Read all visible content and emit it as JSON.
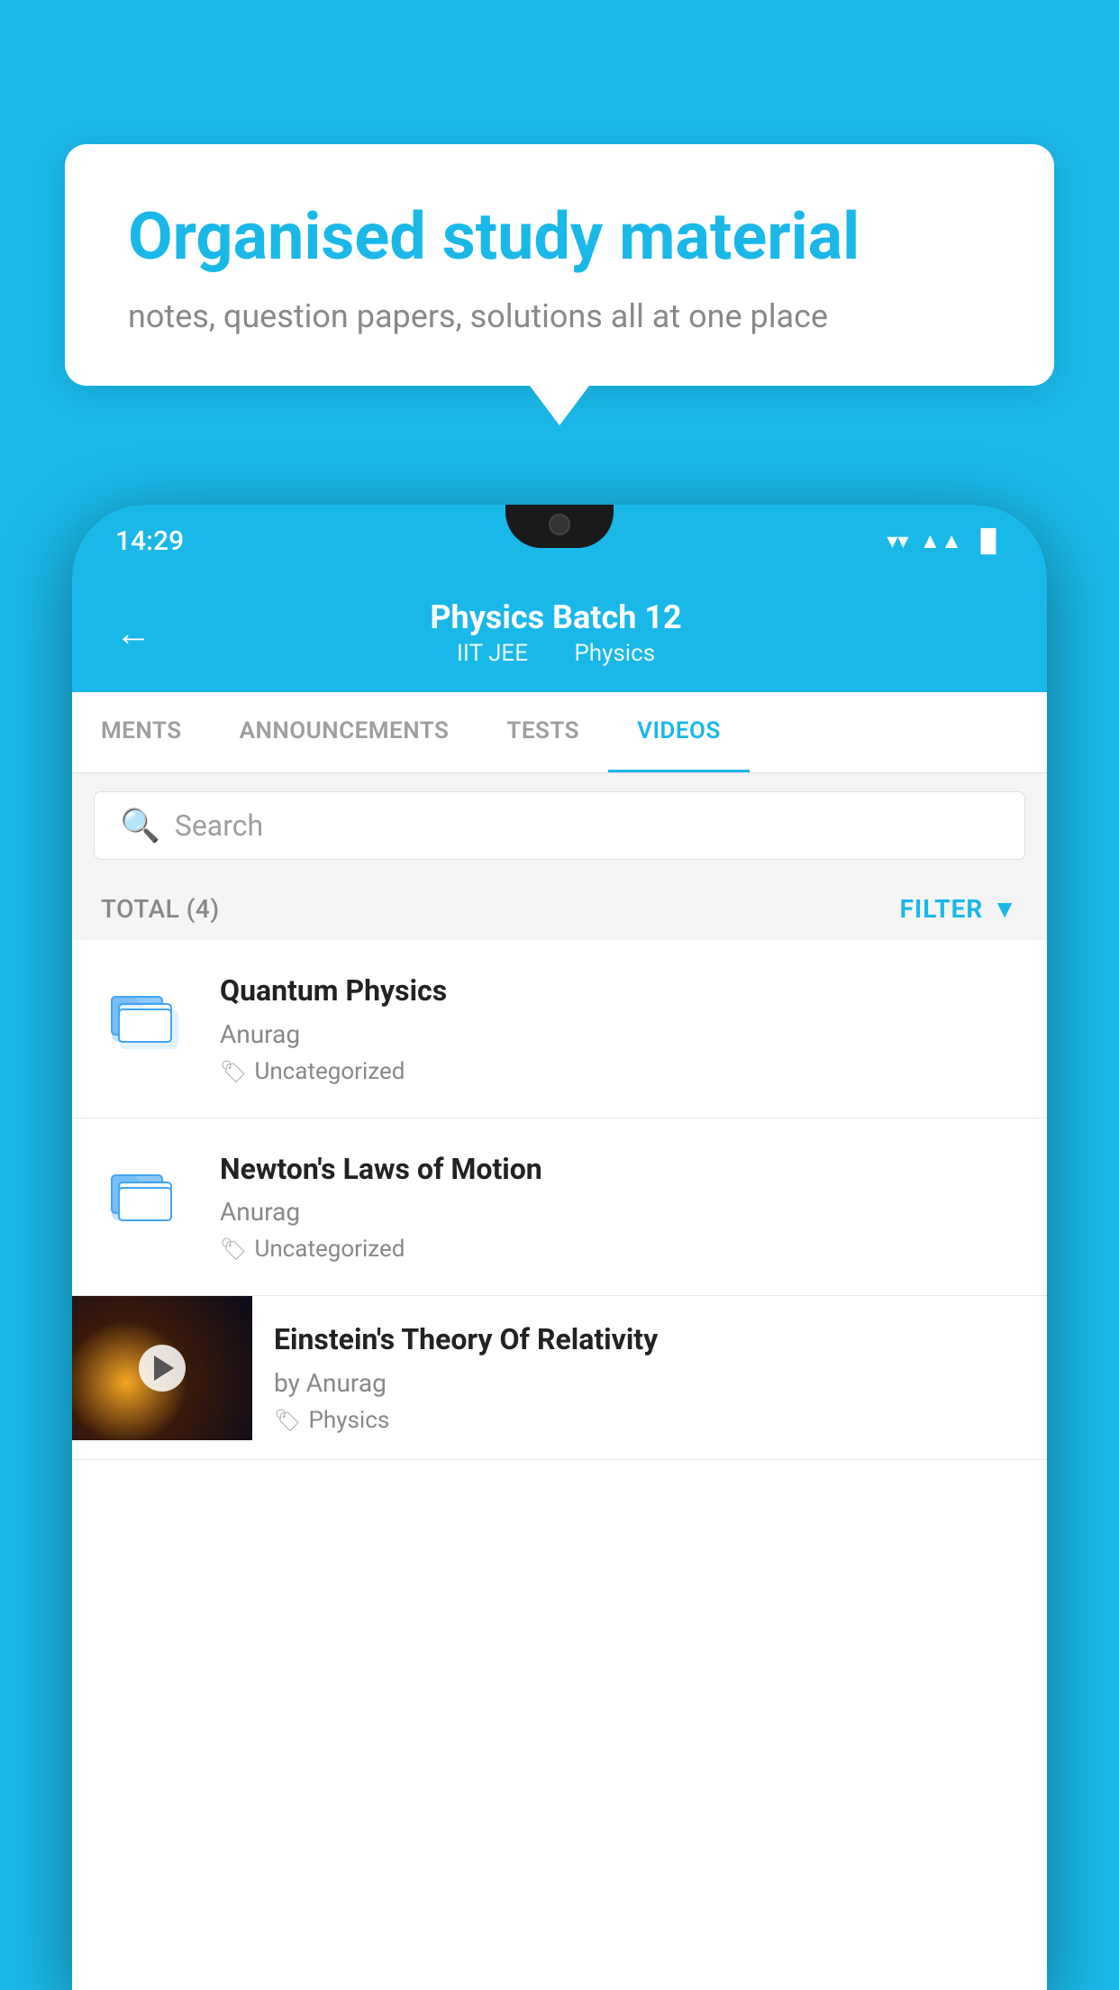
{
  "background_color": "#1ab8e8",
  "speech_bubble": {
    "title": "Organised study material",
    "subtitle": "notes, question papers, solutions all at one place"
  },
  "phone": {
    "status_bar": {
      "time": "14:29",
      "wifi": "▼",
      "signal": "▲",
      "battery": "▐"
    },
    "header": {
      "back_label": "←",
      "title": "Physics Batch 12",
      "tag1": "IIT JEE",
      "tag2": "Physics"
    },
    "tabs": [
      {
        "label": "MENTS",
        "active": false
      },
      {
        "label": "ANNOUNCEMENTS",
        "active": false
      },
      {
        "label": "TESTS",
        "active": false
      },
      {
        "label": "VIDEOS",
        "active": true
      }
    ],
    "search": {
      "placeholder": "Search"
    },
    "filter_row": {
      "total_label": "TOTAL (4)",
      "filter_label": "FILTER"
    },
    "videos": [
      {
        "id": 1,
        "title": "Quantum Physics",
        "author": "Anurag",
        "tag": "Uncategorized",
        "has_thumb": false
      },
      {
        "id": 2,
        "title": "Newton's Laws of Motion",
        "author": "Anurag",
        "tag": "Uncategorized",
        "has_thumb": false
      },
      {
        "id": 3,
        "title": "Einstein's Theory Of Relativity",
        "author": "by Anurag",
        "tag": "Physics",
        "has_thumb": true
      }
    ]
  }
}
